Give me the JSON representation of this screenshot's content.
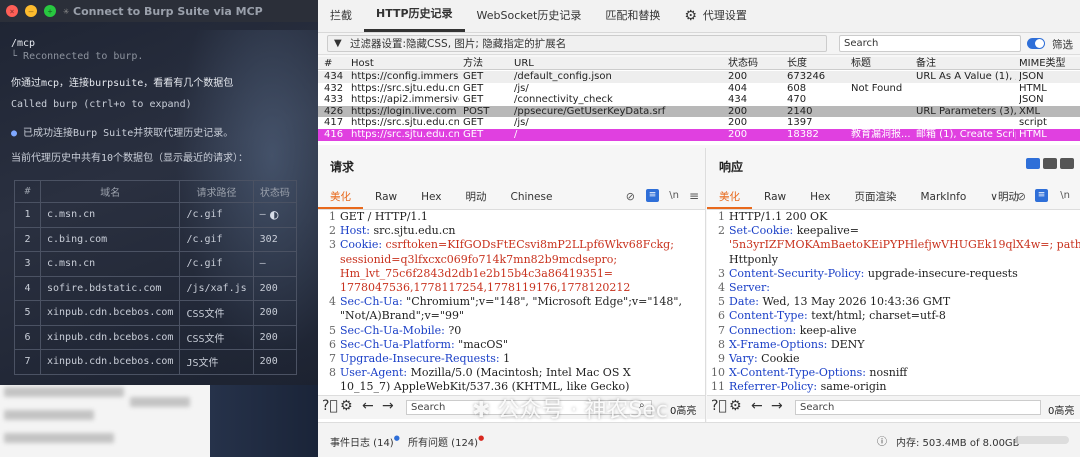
{
  "terminal": {
    "title": "Connect to Burp Suite via MCP",
    "command": "/mcp",
    "reconnected": "Reconnected to burp.",
    "prompt": "你通过mcp，连接burpsuite，看看有几个数据包",
    "called": "Called burp (ctrl+o to expand)",
    "success": "已成功连接Burp Suite并获取代理历史记录。",
    "summary": "当前代理历史中共有10个数据包（显示最近的请求）：",
    "table_headers": [
      "#",
      "域名",
      "请求路径",
      "状态码"
    ],
    "table_rows": [
      [
        "1",
        "c.msn.cn",
        "/c.gif",
        "–"
      ],
      [
        "2",
        "c.bing.com",
        "/c.gif",
        "302"
      ],
      [
        "3",
        "c.msn.cn",
        "/c.gif",
        "–"
      ],
      [
        "4",
        "sofire.bdstatic.com",
        "/js/xaf.js",
        "200"
      ],
      [
        "5",
        "xinpub.cdn.bcebos.com",
        "CSS文件",
        "200"
      ],
      [
        "6",
        "xinpub.cdn.bcebos.com",
        "CSS文件",
        "200"
      ],
      [
        "7",
        "xinpub.cdn.bcebos.com",
        "JS文件",
        "200"
      ]
    ]
  },
  "burp": {
    "main_tabs": [
      "拦截",
      "HTTP历史记录",
      "WebSocket历史记录",
      "匹配和替换",
      "代理设置"
    ],
    "active_main_tab": "HTTP历史记录",
    "filter_text": "过滤器设置:隐藏CSS, 图片; 隐藏指定的扩展名",
    "search_placeholder": "Search",
    "filter_toggle_label": "筛选",
    "grid_headers": [
      "#",
      "Host",
      "方法",
      "URL",
      "状态码",
      "长度",
      "标题",
      "备注",
      "MIME类型"
    ],
    "grid_rows": [
      {
        "n": "434",
        "host": "https://config.immersiv...",
        "method": "GET",
        "url": "/default_config.json",
        "status": "200",
        "len": "673246",
        "title": "",
        "note": "URL As A Value (1), 用...",
        "mime": "JSON",
        "hl": "none"
      },
      {
        "n": "432",
        "host": "https://src.sjtu.edu.cn",
        "method": "GET",
        "url": "/js/",
        "status": "404",
        "len": "608",
        "title": "Not Found",
        "note": "",
        "mime": "HTML",
        "hl": "none"
      },
      {
        "n": "433",
        "host": "https://api2.immersivetr...",
        "method": "GET",
        "url": "/connectivity_check",
        "status": "434",
        "len": "470",
        "title": "",
        "note": "",
        "mime": "JSON",
        "hl": "none"
      },
      {
        "n": "426",
        "host": "https://login.live.com",
        "method": "POST",
        "url": "/ppsecure/GetUserKeyData.srf",
        "status": "200",
        "len": "2140",
        "title": "",
        "note": "URL Parameters (3), A...",
        "mime": "XML",
        "hl": "gray"
      },
      {
        "n": "417",
        "host": "https://src.sjtu.edu.cn",
        "method": "GET",
        "url": "/js/",
        "status": "200",
        "len": "1397",
        "title": "",
        "note": "",
        "mime": "script",
        "hl": "none"
      },
      {
        "n": "416",
        "host": "https://src.sjtu.edu.cn",
        "method": "GET",
        "url": "/",
        "status": "200",
        "len": "18382",
        "title": "教育漏洞报...",
        "note": "邮箱 (1), Create Script ...",
        "mime": "HTML",
        "hl": "magenta"
      }
    ],
    "request": {
      "header": "请求",
      "tabs": [
        "美化",
        "Raw",
        "Hex",
        "明动",
        "Chinese"
      ],
      "lines": [
        {
          "n": "1",
          "k": "GET / HTTP/1.1",
          "v": ""
        },
        {
          "n": "2",
          "k": "Host:",
          "v": " src.sjtu.edu.cn"
        },
        {
          "n": "3",
          "k": "Cookie:",
          "v": " csrftoken=KIfGODsFtECsvi8mP2LLpf6Wkv68Fckg;"
        },
        {
          "n": "",
          "k": "",
          "v": "sessionid=q3lfxcxc069fo714k7mn82b9mcdsepro;"
        },
        {
          "n": "",
          "k": "",
          "v": "Hm_lvt_75c6f2843d2db1e2b15b4c3a86419351="
        },
        {
          "n": "",
          "k": "",
          "v": "1778047536,1778117254,1778119176,1778120212"
        },
        {
          "n": "4",
          "k": "Sec-Ch-Ua:",
          "v": " \"Chromium\";v=\"148\", \"Microsoft Edge\";v=\"148\","
        },
        {
          "n": "",
          "k": "",
          "v": "\"Not/A)Brand\";v=\"99\""
        },
        {
          "n": "5",
          "k": "Sec-Ch-Ua-Mobile:",
          "v": " ?0"
        },
        {
          "n": "6",
          "k": "Sec-Ch-Ua-Platform:",
          "v": " \"macOS\""
        },
        {
          "n": "7",
          "k": "Upgrade-Insecure-Requests:",
          "v": " 1"
        },
        {
          "n": "8",
          "k": "User-Agent:",
          "v": " Mozilla/5.0 (Macintosh; Intel Mac OS X"
        },
        {
          "n": "",
          "k": "",
          "v": "10_15_7) AppleWebKit/537.36 (KHTML, like Gecko)"
        }
      ],
      "search_placeholder": "Search",
      "highlight_count": "0高亮"
    },
    "response": {
      "header": "响应",
      "tabs": [
        "美化",
        "Raw",
        "Hex",
        "页面渲染",
        "MarkInfo",
        "明动"
      ],
      "lines": [
        {
          "n": "1",
          "k": "HTTP/1.1 200 OK",
          "v": ""
        },
        {
          "n": "2",
          "k": "Set-Cookie:",
          "v": " keepalive="
        },
        {
          "n": "",
          "k": "",
          "v": "'5n3yrIZFMOKAmBaetoKEiPYPHlefjwVHUGEk19qlX4w=; path=/;"
        },
        {
          "n": "",
          "k": "",
          "v": "Httponly"
        },
        {
          "n": "3",
          "k": "Content-Security-Policy:",
          "v": " upgrade-insecure-requests"
        },
        {
          "n": "4",
          "k": "Server:",
          "v": ""
        },
        {
          "n": "5",
          "k": "Date:",
          "v": " Wed, 13 May 2026 10:43:36 GMT"
        },
        {
          "n": "6",
          "k": "Content-Type:",
          "v": " text/html; charset=utf-8"
        },
        {
          "n": "7",
          "k": "Connection:",
          "v": " keep-alive"
        },
        {
          "n": "8",
          "k": "X-Frame-Options:",
          "v": " DENY"
        },
        {
          "n": "9",
          "k": "Vary:",
          "v": " Cookie"
        },
        {
          "n": "10",
          "k": "X-Content-Type-Options:",
          "v": " nosniff"
        },
        {
          "n": "11",
          "k": "Referrer-Policy:",
          "v": " same-origin"
        }
      ],
      "search_placeholder": "Search",
      "highlight_count": "0高亮"
    },
    "status": {
      "event_log": "事件日志 (14)",
      "issues": "所有问题 (124)",
      "memory": "内存: 503.4MB of 8.00GB"
    },
    "watermark": "公众号 · 神农Sec",
    "colors": {
      "magenta": "#e040e0",
      "gray": "#b8b8b8",
      "accent": "#e8691c",
      "blue": "#2f6fd8"
    }
  }
}
